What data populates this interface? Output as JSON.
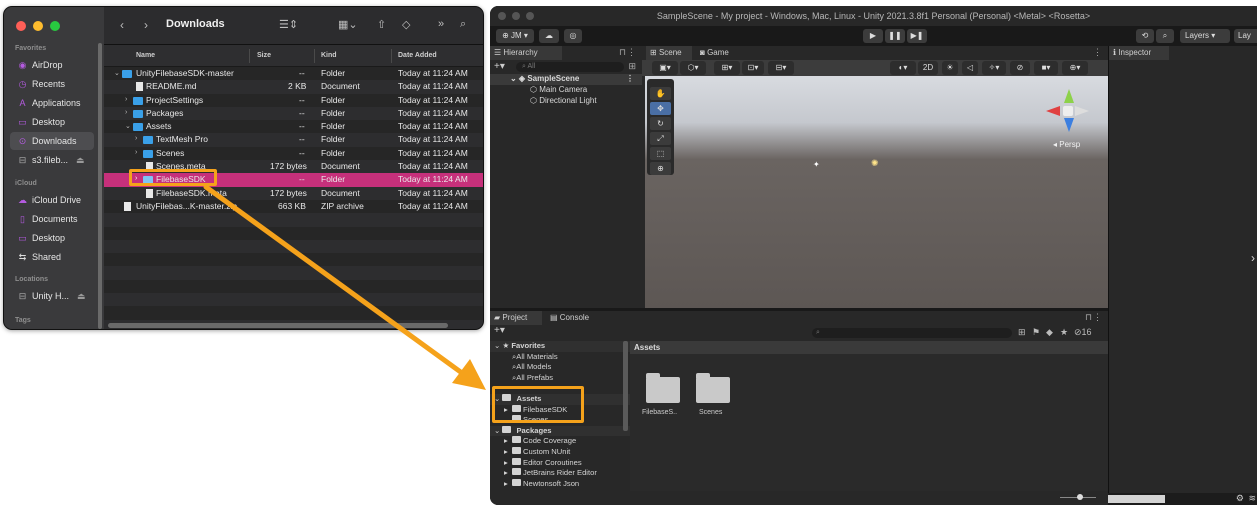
{
  "finder": {
    "title": "Downloads",
    "sidebar": {
      "favorites_label": "Favorites",
      "favorites": [
        {
          "icon": "airdrop-icon",
          "label": "AirDrop"
        },
        {
          "icon": "clock-icon",
          "label": "Recents"
        },
        {
          "icon": "applications-icon",
          "label": "Applications"
        },
        {
          "icon": "desktop-icon",
          "label": "Desktop"
        },
        {
          "icon": "download-icon",
          "label": "Downloads"
        },
        {
          "icon": "drive-icon",
          "label": "s3.fileb..."
        }
      ],
      "icloud_label": "iCloud",
      "icloud": [
        {
          "icon": "cloud-icon",
          "label": "iCloud Drive"
        },
        {
          "icon": "document-icon",
          "label": "Documents"
        },
        {
          "icon": "desktop-icon",
          "label": "Desktop"
        },
        {
          "icon": "shared-folder-icon",
          "label": "Shared"
        }
      ],
      "locations_label": "Locations",
      "locations": [
        {
          "icon": "drive-icon",
          "label": "Unity H..."
        }
      ],
      "tags_label": "Tags"
    },
    "columns": {
      "name": "Name",
      "size": "Size",
      "kind": "Kind",
      "date": "Date Added"
    },
    "rows": [
      {
        "name": "UnityFilebaseSDK-master",
        "size": "--",
        "kind": "Folder",
        "date": "Today at 11:24 AM"
      },
      {
        "name": "README.md",
        "size": "2 KB",
        "kind": "Document",
        "date": "Today at 11:24 AM"
      },
      {
        "name": "ProjectSettings",
        "size": "--",
        "kind": "Folder",
        "date": "Today at 11:24 AM"
      },
      {
        "name": "Packages",
        "size": "--",
        "kind": "Folder",
        "date": "Today at 11:24 AM"
      },
      {
        "name": "Assets",
        "size": "--",
        "kind": "Folder",
        "date": "Today at 11:24 AM"
      },
      {
        "name": "TextMesh Pro",
        "size": "--",
        "kind": "Folder",
        "date": "Today at 11:24 AM"
      },
      {
        "name": "Scenes",
        "size": "--",
        "kind": "Folder",
        "date": "Today at 11:24 AM"
      },
      {
        "name": "Scenes.meta",
        "size": "172 bytes",
        "kind": "Document",
        "date": "Today at 11:24 AM"
      },
      {
        "name": "FilebaseSDK",
        "size": "--",
        "kind": "Folder",
        "date": "Today at 11:24 AM"
      },
      {
        "name": "FilebaseSDK.meta",
        "size": "172 bytes",
        "kind": "Document",
        "date": "Today at 11:24 AM"
      },
      {
        "name": "UnityFilebas...K-master.zip",
        "size": "663 KB",
        "kind": "ZIP archive",
        "date": "Today at 11:24 AM"
      }
    ]
  },
  "unity": {
    "window_title": "SampleScene - My project - Windows, Mac, Linux - Unity 2021.3.8f1 Personal (Personal) <Metal> <Rosetta>",
    "account": "JM",
    "layers_label": "Layers",
    "layout_label": "Lay",
    "tabs": {
      "hierarchy": "Hierarchy",
      "scene": "Scene",
      "game": "Game",
      "inspector": "Inspector",
      "project": "Project",
      "console": "Console"
    },
    "hierarchy": {
      "search_placeholder": "All",
      "scene": "SampleScene",
      "items": [
        "Main Camera",
        "Directional Light"
      ]
    },
    "scene_view": {
      "mode_2d": "2D",
      "persp_label": "Persp"
    },
    "project": {
      "favorites_label": "Favorites",
      "favorites": [
        "All Materials",
        "All Models",
        "All Prefabs"
      ],
      "assets_label": "Assets",
      "assets": [
        "FilebaseSDK",
        "Scenes"
      ],
      "packages_label": "Packages",
      "packages": [
        "Code Coverage",
        "Custom NUnit",
        "Editor Coroutines",
        "JetBrains Rider Editor",
        "Newtonsoft Json"
      ],
      "breadcrumb": "Assets",
      "grid_items": [
        "FilebaseS..",
        "Scenes"
      ],
      "hidden_count": "16"
    }
  },
  "colors": {
    "highlight": "#f5a21b",
    "selection": "#c6307b",
    "folder_blue": "#3aa0e8"
  }
}
